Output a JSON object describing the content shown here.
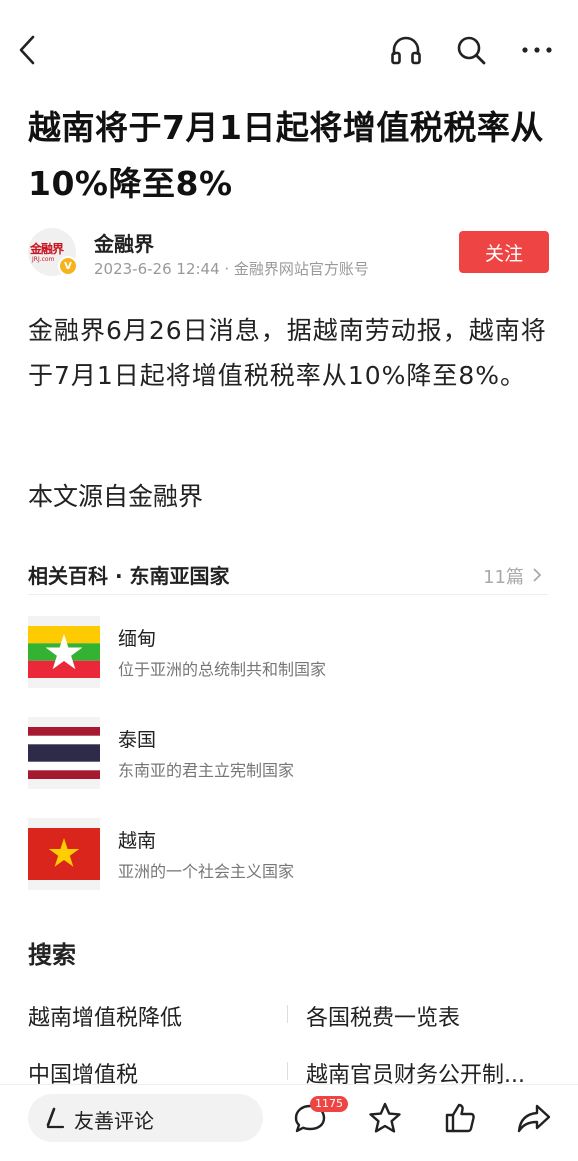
{
  "header": {
    "back_icon": "back-arrow-icon",
    "listen_icon": "headphones-icon",
    "search_icon": "search-icon",
    "more_icon": "more-dots-icon"
  },
  "article": {
    "title": "越南将于7月1日起将增值税税率从10%降至8%",
    "author": {
      "name": "金融界",
      "avatar_text": "金融界",
      "avatar_subtext": "JRJ.com",
      "verified_badge": "V",
      "meta": "2023-6-26 12:44 · 金融界网站官方账号",
      "follow_label": "关注"
    },
    "body": "金融界6月26日消息，据越南劳动报，越南将于7月1日起将增值税税率从10%降至8%。",
    "source_line": "本文源自金融界"
  },
  "related": {
    "title": "相关百科 · 东南亚国家",
    "count": "11篇",
    "items": [
      {
        "name": "缅甸",
        "desc": "位于亚洲的总统制共和制国家"
      },
      {
        "name": "泰国",
        "desc": "东南亚的君主立宪制国家"
      },
      {
        "name": "越南",
        "desc": "亚洲的一个社会主义国家"
      }
    ]
  },
  "search": {
    "title": "搜索",
    "links": [
      "越南增值税降低",
      "各国税费一览表",
      "中国增值税",
      "越南官员财务公开制..."
    ]
  },
  "bottom": {
    "comment_placeholder": "友善评论",
    "comment_count": "1175",
    "colors": {
      "accent": "#ef4444"
    }
  }
}
